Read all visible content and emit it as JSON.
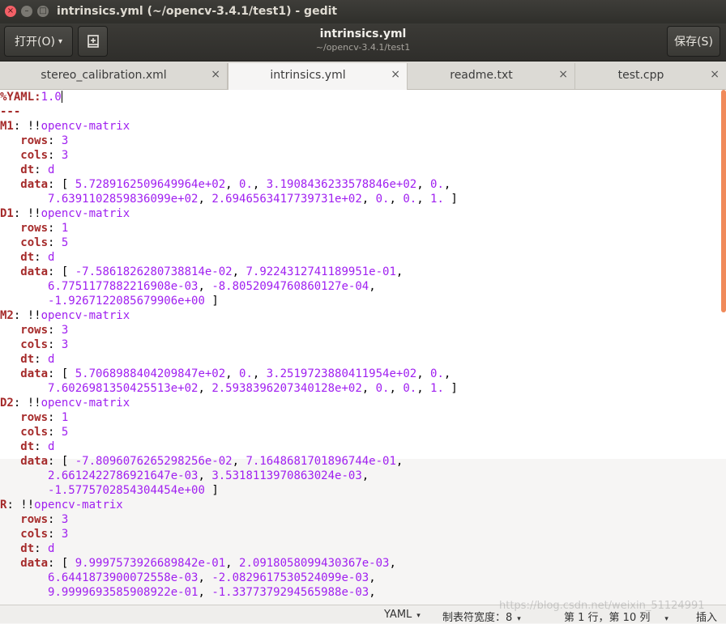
{
  "window": {
    "title": "intrinsics.yml (~/opencv-3.4.1/test1) - gedit",
    "close_glyph": "×",
    "minimize_glyph": "–",
    "maximize_glyph": "□"
  },
  "header": {
    "open_label": "打开(O)",
    "open_caret": "▾",
    "new_doc_icon": "new-document-icon",
    "doc_title": "intrinsics.yml",
    "doc_path": "~/opencv-3.4.1/test1",
    "save_label": "保存(S)"
  },
  "tabs": [
    {
      "label": "stereo_calibration.xml",
      "close": "×"
    },
    {
      "label": "intrinsics.yml",
      "close": "×",
      "active": true
    },
    {
      "label": "readme.txt",
      "close": "×"
    },
    {
      "label": "test.cpp",
      "close": "×"
    }
  ],
  "code_lines": [
    [
      {
        "t": "%YAML:",
        "c": "k"
      },
      {
        "t": "1.0",
        "c": "v"
      }
    ],
    [
      {
        "t": "---",
        "c": "k"
      }
    ],
    [
      {
        "t": "M1",
        "c": "k"
      },
      {
        "t": ": !!",
        "c": "p"
      },
      {
        "t": "opencv-matrix",
        "c": "v"
      }
    ],
    [
      {
        "t": "   rows",
        "c": "k"
      },
      {
        "t": ": ",
        "c": "p"
      },
      {
        "t": "3",
        "c": "v"
      }
    ],
    [
      {
        "t": "   cols",
        "c": "k"
      },
      {
        "t": ": ",
        "c": "p"
      },
      {
        "t": "3",
        "c": "v"
      }
    ],
    [
      {
        "t": "   dt",
        "c": "k"
      },
      {
        "t": ": ",
        "c": "p"
      },
      {
        "t": "d",
        "c": "v"
      }
    ],
    [
      {
        "t": "   data",
        "c": "k"
      },
      {
        "t": ": [ ",
        "c": "p"
      },
      {
        "t": "5.7289162509649964e+02",
        "c": "v"
      },
      {
        "t": ", ",
        "c": "p"
      },
      {
        "t": "0.",
        "c": "v"
      },
      {
        "t": ", ",
        "c": "p"
      },
      {
        "t": "3.1908436233578846e+02",
        "c": "v"
      },
      {
        "t": ", ",
        "c": "p"
      },
      {
        "t": "0.",
        "c": "v"
      },
      {
        "t": ",",
        "c": "p"
      }
    ],
    [
      {
        "t": "       ",
        "c": "p"
      },
      {
        "t": "7.6391102859836099e+02",
        "c": "v"
      },
      {
        "t": ", ",
        "c": "p"
      },
      {
        "t": "2.6946563417739731e+02",
        "c": "v"
      },
      {
        "t": ", ",
        "c": "p"
      },
      {
        "t": "0.",
        "c": "v"
      },
      {
        "t": ", ",
        "c": "p"
      },
      {
        "t": "0.",
        "c": "v"
      },
      {
        "t": ", ",
        "c": "p"
      },
      {
        "t": "1.",
        "c": "v"
      },
      {
        "t": " ]",
        "c": "p"
      }
    ],
    [
      {
        "t": "D1",
        "c": "k"
      },
      {
        "t": ": !!",
        "c": "p"
      },
      {
        "t": "opencv-matrix",
        "c": "v"
      }
    ],
    [
      {
        "t": "   rows",
        "c": "k"
      },
      {
        "t": ": ",
        "c": "p"
      },
      {
        "t": "1",
        "c": "v"
      }
    ],
    [
      {
        "t": "   cols",
        "c": "k"
      },
      {
        "t": ": ",
        "c": "p"
      },
      {
        "t": "5",
        "c": "v"
      }
    ],
    [
      {
        "t": "   dt",
        "c": "k"
      },
      {
        "t": ": ",
        "c": "p"
      },
      {
        "t": "d",
        "c": "v"
      }
    ],
    [
      {
        "t": "   data",
        "c": "k"
      },
      {
        "t": ": [ ",
        "c": "p"
      },
      {
        "t": "-7.5861826280738814e-02",
        "c": "v"
      },
      {
        "t": ", ",
        "c": "p"
      },
      {
        "t": "7.9224312741189951e-01",
        "c": "v"
      },
      {
        "t": ",",
        "c": "p"
      }
    ],
    [
      {
        "t": "       ",
        "c": "p"
      },
      {
        "t": "6.7751177882216908e-03",
        "c": "v"
      },
      {
        "t": ", ",
        "c": "p"
      },
      {
        "t": "-8.8052094760860127e-04",
        "c": "v"
      },
      {
        "t": ",",
        "c": "p"
      }
    ],
    [
      {
        "t": "       ",
        "c": "p"
      },
      {
        "t": "-1.9267122085679906e+00",
        "c": "v"
      },
      {
        "t": " ]",
        "c": "p"
      }
    ],
    [
      {
        "t": "M2",
        "c": "k"
      },
      {
        "t": ": !!",
        "c": "p"
      },
      {
        "t": "opencv-matrix",
        "c": "v"
      }
    ],
    [
      {
        "t": "   rows",
        "c": "k"
      },
      {
        "t": ": ",
        "c": "p"
      },
      {
        "t": "3",
        "c": "v"
      }
    ],
    [
      {
        "t": "   cols",
        "c": "k"
      },
      {
        "t": ": ",
        "c": "p"
      },
      {
        "t": "3",
        "c": "v"
      }
    ],
    [
      {
        "t": "   dt",
        "c": "k"
      },
      {
        "t": ": ",
        "c": "p"
      },
      {
        "t": "d",
        "c": "v"
      }
    ],
    [
      {
        "t": "   data",
        "c": "k"
      },
      {
        "t": ": [ ",
        "c": "p"
      },
      {
        "t": "5.7068988404209847e+02",
        "c": "v"
      },
      {
        "t": ", ",
        "c": "p"
      },
      {
        "t": "0.",
        "c": "v"
      },
      {
        "t": ", ",
        "c": "p"
      },
      {
        "t": "3.2519723880411954e+02",
        "c": "v"
      },
      {
        "t": ", ",
        "c": "p"
      },
      {
        "t": "0.",
        "c": "v"
      },
      {
        "t": ",",
        "c": "p"
      }
    ],
    [
      {
        "t": "       ",
        "c": "p"
      },
      {
        "t": "7.6026981350425513e+02",
        "c": "v"
      },
      {
        "t": ", ",
        "c": "p"
      },
      {
        "t": "2.5938396207340128e+02",
        "c": "v"
      },
      {
        "t": ", ",
        "c": "p"
      },
      {
        "t": "0.",
        "c": "v"
      },
      {
        "t": ", ",
        "c": "p"
      },
      {
        "t": "0.",
        "c": "v"
      },
      {
        "t": ", ",
        "c": "p"
      },
      {
        "t": "1.",
        "c": "v"
      },
      {
        "t": " ]",
        "c": "p"
      }
    ],
    [
      {
        "t": "D2",
        "c": "k"
      },
      {
        "t": ": !!",
        "c": "p"
      },
      {
        "t": "opencv-matrix",
        "c": "v"
      }
    ],
    [
      {
        "t": "   rows",
        "c": "k"
      },
      {
        "t": ": ",
        "c": "p"
      },
      {
        "t": "1",
        "c": "v"
      }
    ],
    [
      {
        "t": "   cols",
        "c": "k"
      },
      {
        "t": ": ",
        "c": "p"
      },
      {
        "t": "5",
        "c": "v"
      }
    ],
    [
      {
        "t": "   dt",
        "c": "k"
      },
      {
        "t": ": ",
        "c": "p"
      },
      {
        "t": "d",
        "c": "v"
      }
    ],
    [
      {
        "t": "   data",
        "c": "k"
      },
      {
        "t": ": [ ",
        "c": "p"
      },
      {
        "t": "-7.8096076265298256e-02",
        "c": "v"
      },
      {
        "t": ", ",
        "c": "p"
      },
      {
        "t": "7.1648681701896744e-01",
        "c": "v"
      },
      {
        "t": ",",
        "c": "p"
      }
    ],
    [
      {
        "t": "       ",
        "c": "p"
      },
      {
        "t": "2.6612422786921647e-03",
        "c": "v"
      },
      {
        "t": ", ",
        "c": "p"
      },
      {
        "t": "3.5318113970863024e-03",
        "c": "v"
      },
      {
        "t": ",",
        "c": "p"
      }
    ],
    [
      {
        "t": "       ",
        "c": "p"
      },
      {
        "t": "-1.5775702854304454e+00",
        "c": "v"
      },
      {
        "t": " ]",
        "c": "p"
      }
    ],
    [
      {
        "t": "R",
        "c": "k"
      },
      {
        "t": ": !!",
        "c": "p"
      },
      {
        "t": "opencv-matrix",
        "c": "v"
      }
    ],
    [
      {
        "t": "   rows",
        "c": "k"
      },
      {
        "t": ": ",
        "c": "p"
      },
      {
        "t": "3",
        "c": "v"
      }
    ],
    [
      {
        "t": "   cols",
        "c": "k"
      },
      {
        "t": ": ",
        "c": "p"
      },
      {
        "t": "3",
        "c": "v"
      }
    ],
    [
      {
        "t": "   dt",
        "c": "k"
      },
      {
        "t": ": ",
        "c": "p"
      },
      {
        "t": "d",
        "c": "v"
      }
    ],
    [
      {
        "t": "   data",
        "c": "k"
      },
      {
        "t": ": [ ",
        "c": "p"
      },
      {
        "t": "9.9997573926689842e-01",
        "c": "v"
      },
      {
        "t": ", ",
        "c": "p"
      },
      {
        "t": "2.0918058099430367e-03",
        "c": "v"
      },
      {
        "t": ",",
        "c": "p"
      }
    ],
    [
      {
        "t": "       ",
        "c": "p"
      },
      {
        "t": "6.6441873900072558e-03",
        "c": "v"
      },
      {
        "t": ", ",
        "c": "p"
      },
      {
        "t": "-2.0829617530524099e-03",
        "c": "v"
      },
      {
        "t": ",",
        "c": "p"
      }
    ],
    [
      {
        "t": "       ",
        "c": "p"
      },
      {
        "t": "9.9999693585908922e-01",
        "c": "v"
      },
      {
        "t": ", ",
        "c": "p"
      },
      {
        "t": "-1.3377379294565988e-03",
        "c": "v"
      },
      {
        "t": ",",
        "c": "p"
      }
    ]
  ],
  "status": {
    "language": "YAML",
    "tab_width": "制表符宽度：8",
    "position": "第 1 行，第 10 列",
    "mode": "插入",
    "caret": "▾"
  },
  "watermark": "https://blog.csdn.net/weixin_51124991"
}
